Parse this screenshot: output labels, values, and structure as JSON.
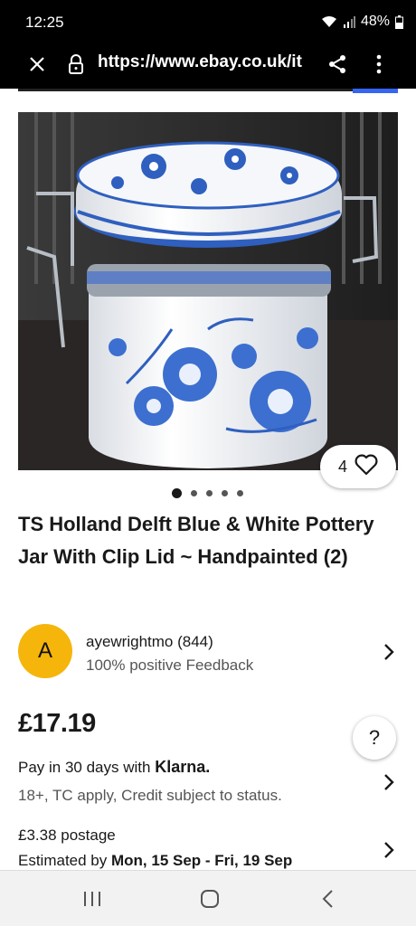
{
  "status": {
    "time": "12:25",
    "battery": "48%"
  },
  "browser": {
    "url": "https://www.ebay.co.uk/it",
    "icons": [
      "close-icon",
      "lock-icon",
      "share-icon",
      "more-vert-icon"
    ]
  },
  "product": {
    "like_count": "4",
    "title": "TS Holland Delft Blue & White Pottery Jar With Clip Lid ~ Handpainted (2)",
    "image_count": 5,
    "active_image_index": 0
  },
  "seller": {
    "avatar_letter": "A",
    "name": "ayewrightmo (844)",
    "feedback": "100% positive Feedback"
  },
  "price": {
    "amount": "£17.19"
  },
  "help": {
    "label": "?"
  },
  "klarna": {
    "text": "Pay in 30 days with",
    "brand": "Klarna.",
    "subtext": "18+, TC apply, Credit subject to status."
  },
  "postage": {
    "cost": "£3.38 postage",
    "estimate_label": "Estimated by",
    "estimate_dates": "Mon, 15 Sep - Fri, 19 Sep"
  },
  "colors": {
    "accent": "#3665f3",
    "avatar": "#f5b50a",
    "delft_blue": "#2f5fbf"
  }
}
